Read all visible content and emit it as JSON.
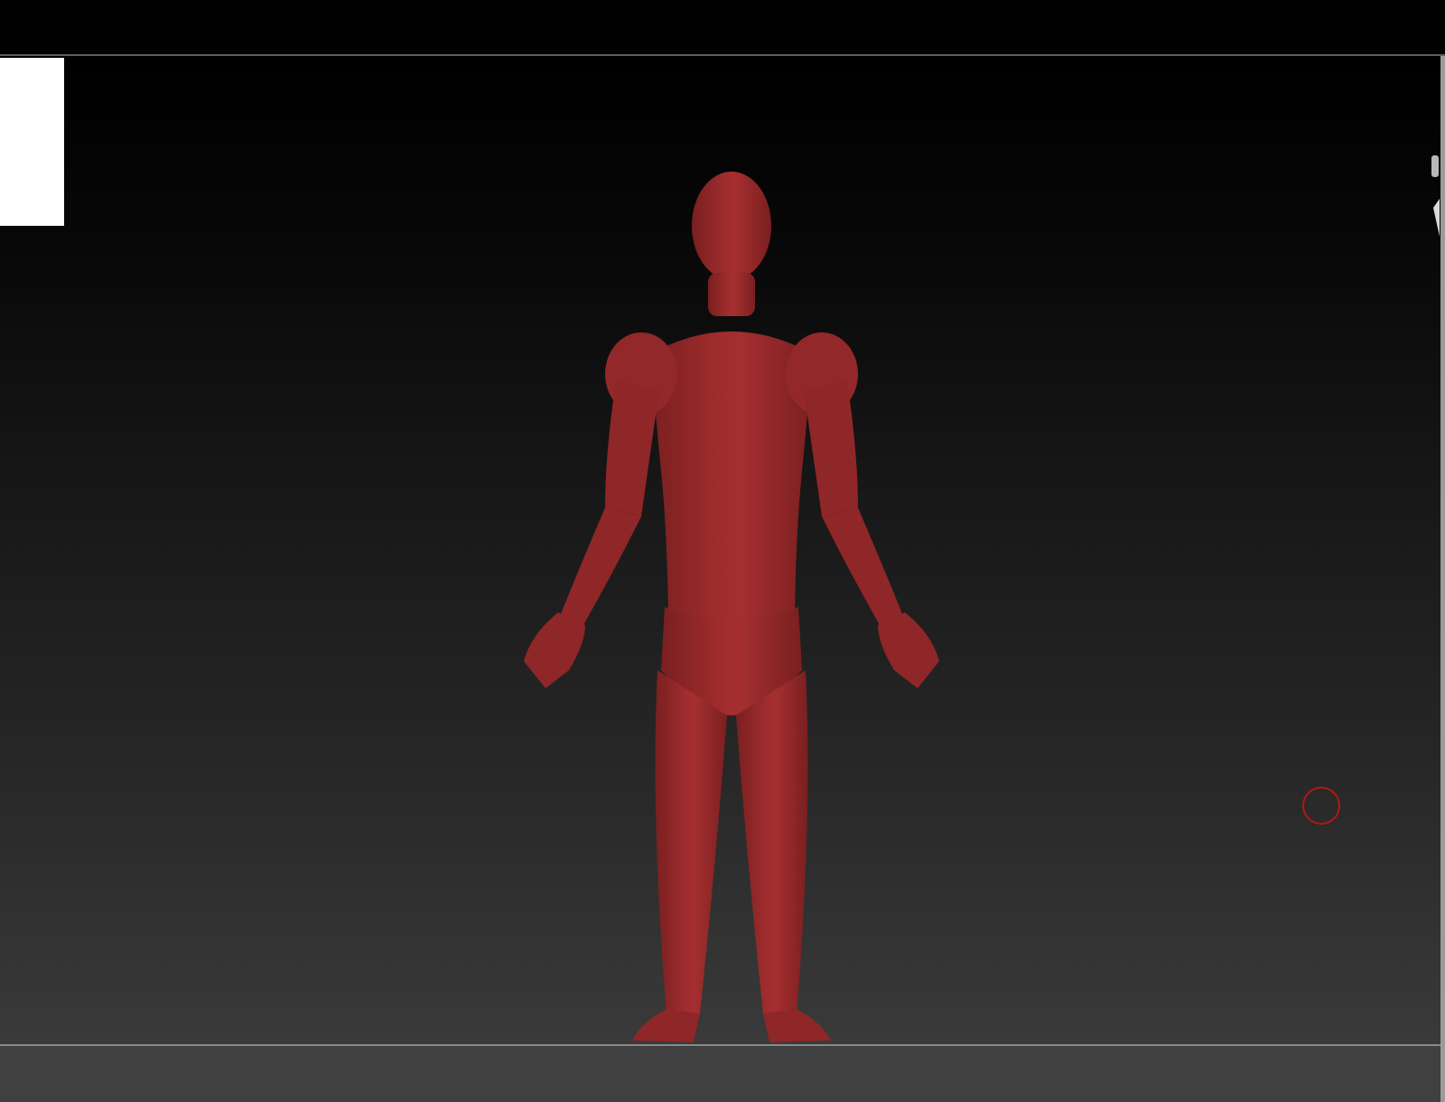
{
  "app": {
    "canvas": {
      "model_color": "#9e2a2b",
      "model_shadow_color": "#6f1b1c",
      "background_top": "#000000",
      "background_bottom": "#3a3a3a"
    },
    "marker": {
      "color": "#b11717",
      "icon": "target-circle-icon"
    },
    "gizmo": {
      "icon": "navigation-gizmo-icon"
    }
  }
}
